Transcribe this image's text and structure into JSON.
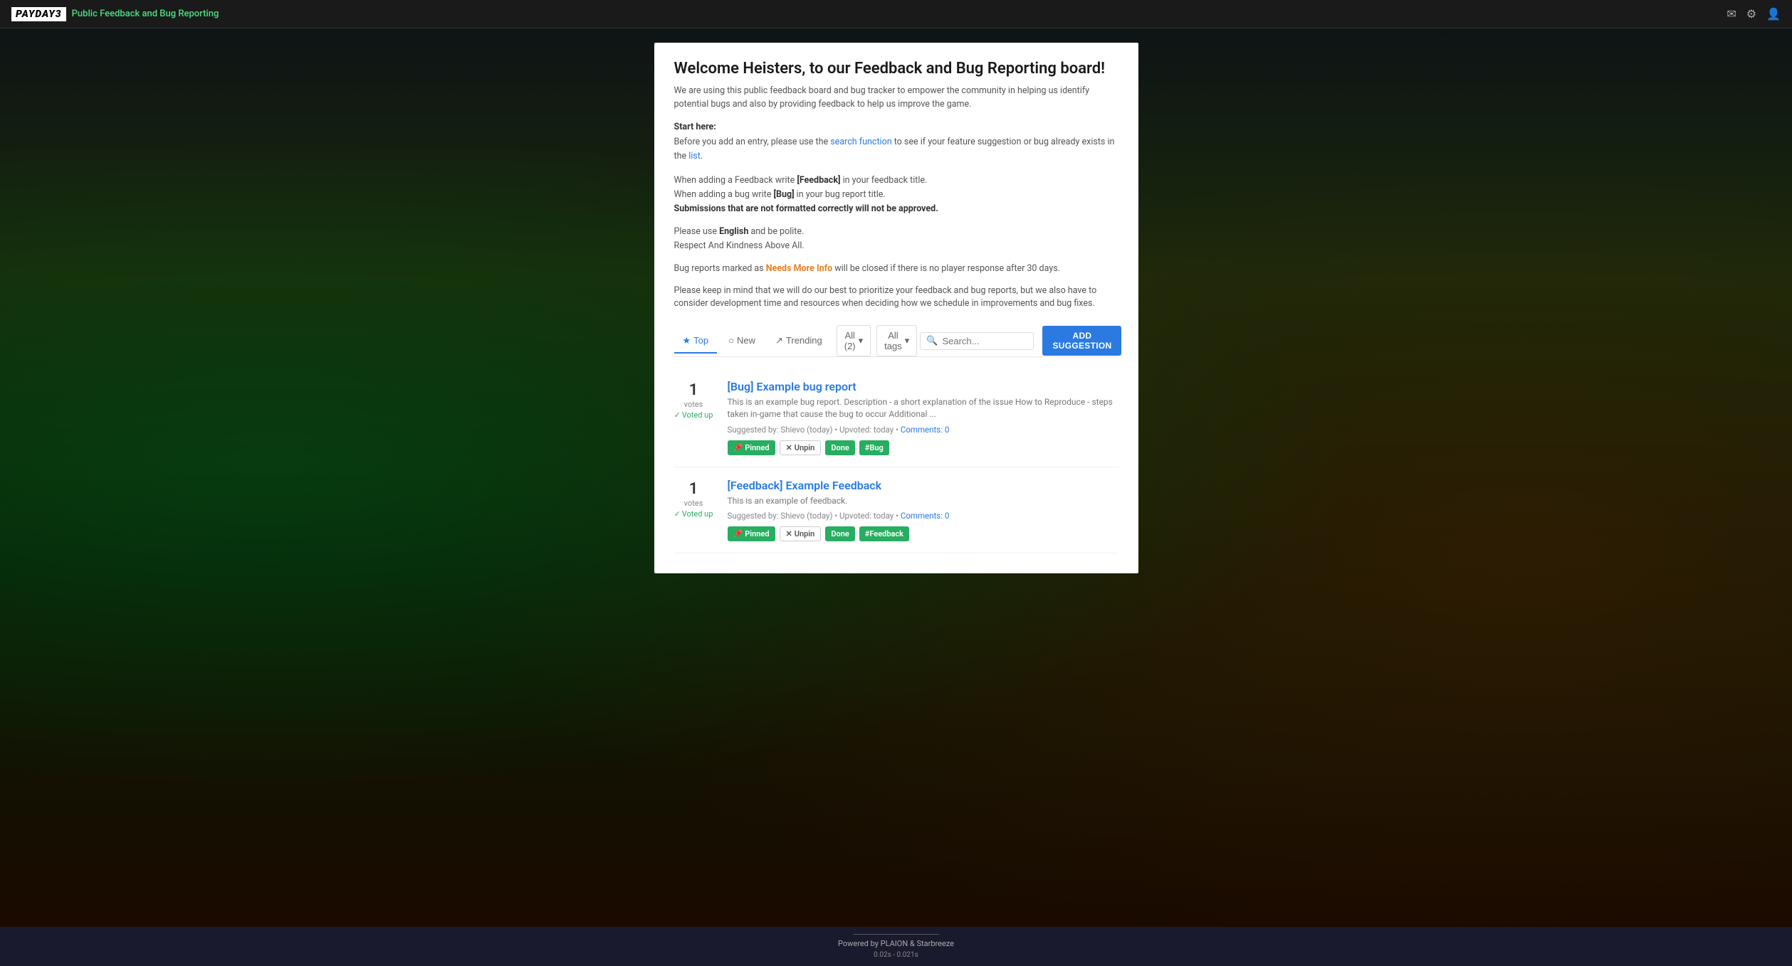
{
  "navbar": {
    "logo_text": "PAYDAY3",
    "title": "Public Feedback and Bug Reporting",
    "icons": {
      "mail": "✉",
      "settings": "⚙",
      "user": "👤"
    }
  },
  "main": {
    "welcome_title": "Welcome Heisters, to our Feedback and Bug Reporting board!",
    "description": "We are using this public feedback board and bug tracker to empower the community in helping us identify potential bugs and also by providing feedback to help us improve the game.",
    "start_here_label": "Start here:",
    "before_entry": "Before you add an entry, please use the",
    "search_function_link": "search function",
    "before_entry_2": "to see if your feature suggestion or bug already exists in the",
    "list_link": "list",
    "feedback_instruction": "When adding a Feedback write",
    "feedback_tag": "[Feedback]",
    "feedback_instruction_2": "in your feedback title.",
    "bug_instruction": "When adding a bug write",
    "bug_tag": "[Bug]",
    "bug_instruction_2": "in your bug report title.",
    "format_warning": "Submissions that are not formatted correctly will not be approved.",
    "language_note_1": "Please use",
    "language_english": "English",
    "language_note_2": "and be polite.",
    "respect_note": "Respect And Kindness Above All.",
    "needs_more_info_prefix": "Bug reports marked as",
    "needs_more_info_tag": "Needs More Info",
    "needs_more_info_suffix": "will be closed if there is no player response after 30 days.",
    "prioritize_note": "Please keep in mind that we will do our best to prioritize your feedback and bug reports, but we also have to consider development time and resources when deciding how we schedule in improvements and bug fixes."
  },
  "filters": {
    "top_label": "Top",
    "new_label": "New",
    "trending_label": "Trending",
    "all_label": "All (2)",
    "all_tags_label": "All tags",
    "search_placeholder": "Search...",
    "add_button_label": "ADD SUGGESTION"
  },
  "suggestions": [
    {
      "id": 1,
      "vote_count": "1",
      "vote_label": "votes",
      "voted_up_label": "Voted up",
      "title": "[Bug] Example bug report",
      "description": "This is an example bug report. Description - a short explanation of the issue How to Reproduce - steps taken in-game that cause the bug to occur Additional ...",
      "suggested_by": "Shievo",
      "suggested_time": "today",
      "upvoted_time": "today",
      "comments_label": "Comments: 0",
      "tags": [
        {
          "label": "Pinned",
          "icon": "📌",
          "type": "pinned"
        },
        {
          "label": "Unpin",
          "icon": "✕",
          "type": "unpin"
        },
        {
          "label": "Done",
          "type": "done"
        },
        {
          "label": "#Bug",
          "type": "bug"
        }
      ]
    },
    {
      "id": 2,
      "vote_count": "1",
      "vote_label": "votes",
      "voted_up_label": "Voted up",
      "title": "[Feedback] Example Feedback",
      "description": "This is an example of feedback.",
      "suggested_by": "Shievo",
      "suggested_time": "today",
      "upvoted_time": "today",
      "comments_label": "Comments: 0",
      "tags": [
        {
          "label": "Pinned",
          "icon": "📌",
          "type": "pinned"
        },
        {
          "label": "Unpin",
          "icon": "✕",
          "type": "unpin"
        },
        {
          "label": "Done",
          "type": "done"
        },
        {
          "label": "#Feedback",
          "type": "feedback"
        }
      ]
    }
  ],
  "footer": {
    "powered_by": "Powered by PLAION & Starbreeze",
    "timing": "0.02s - 0.021s"
  }
}
